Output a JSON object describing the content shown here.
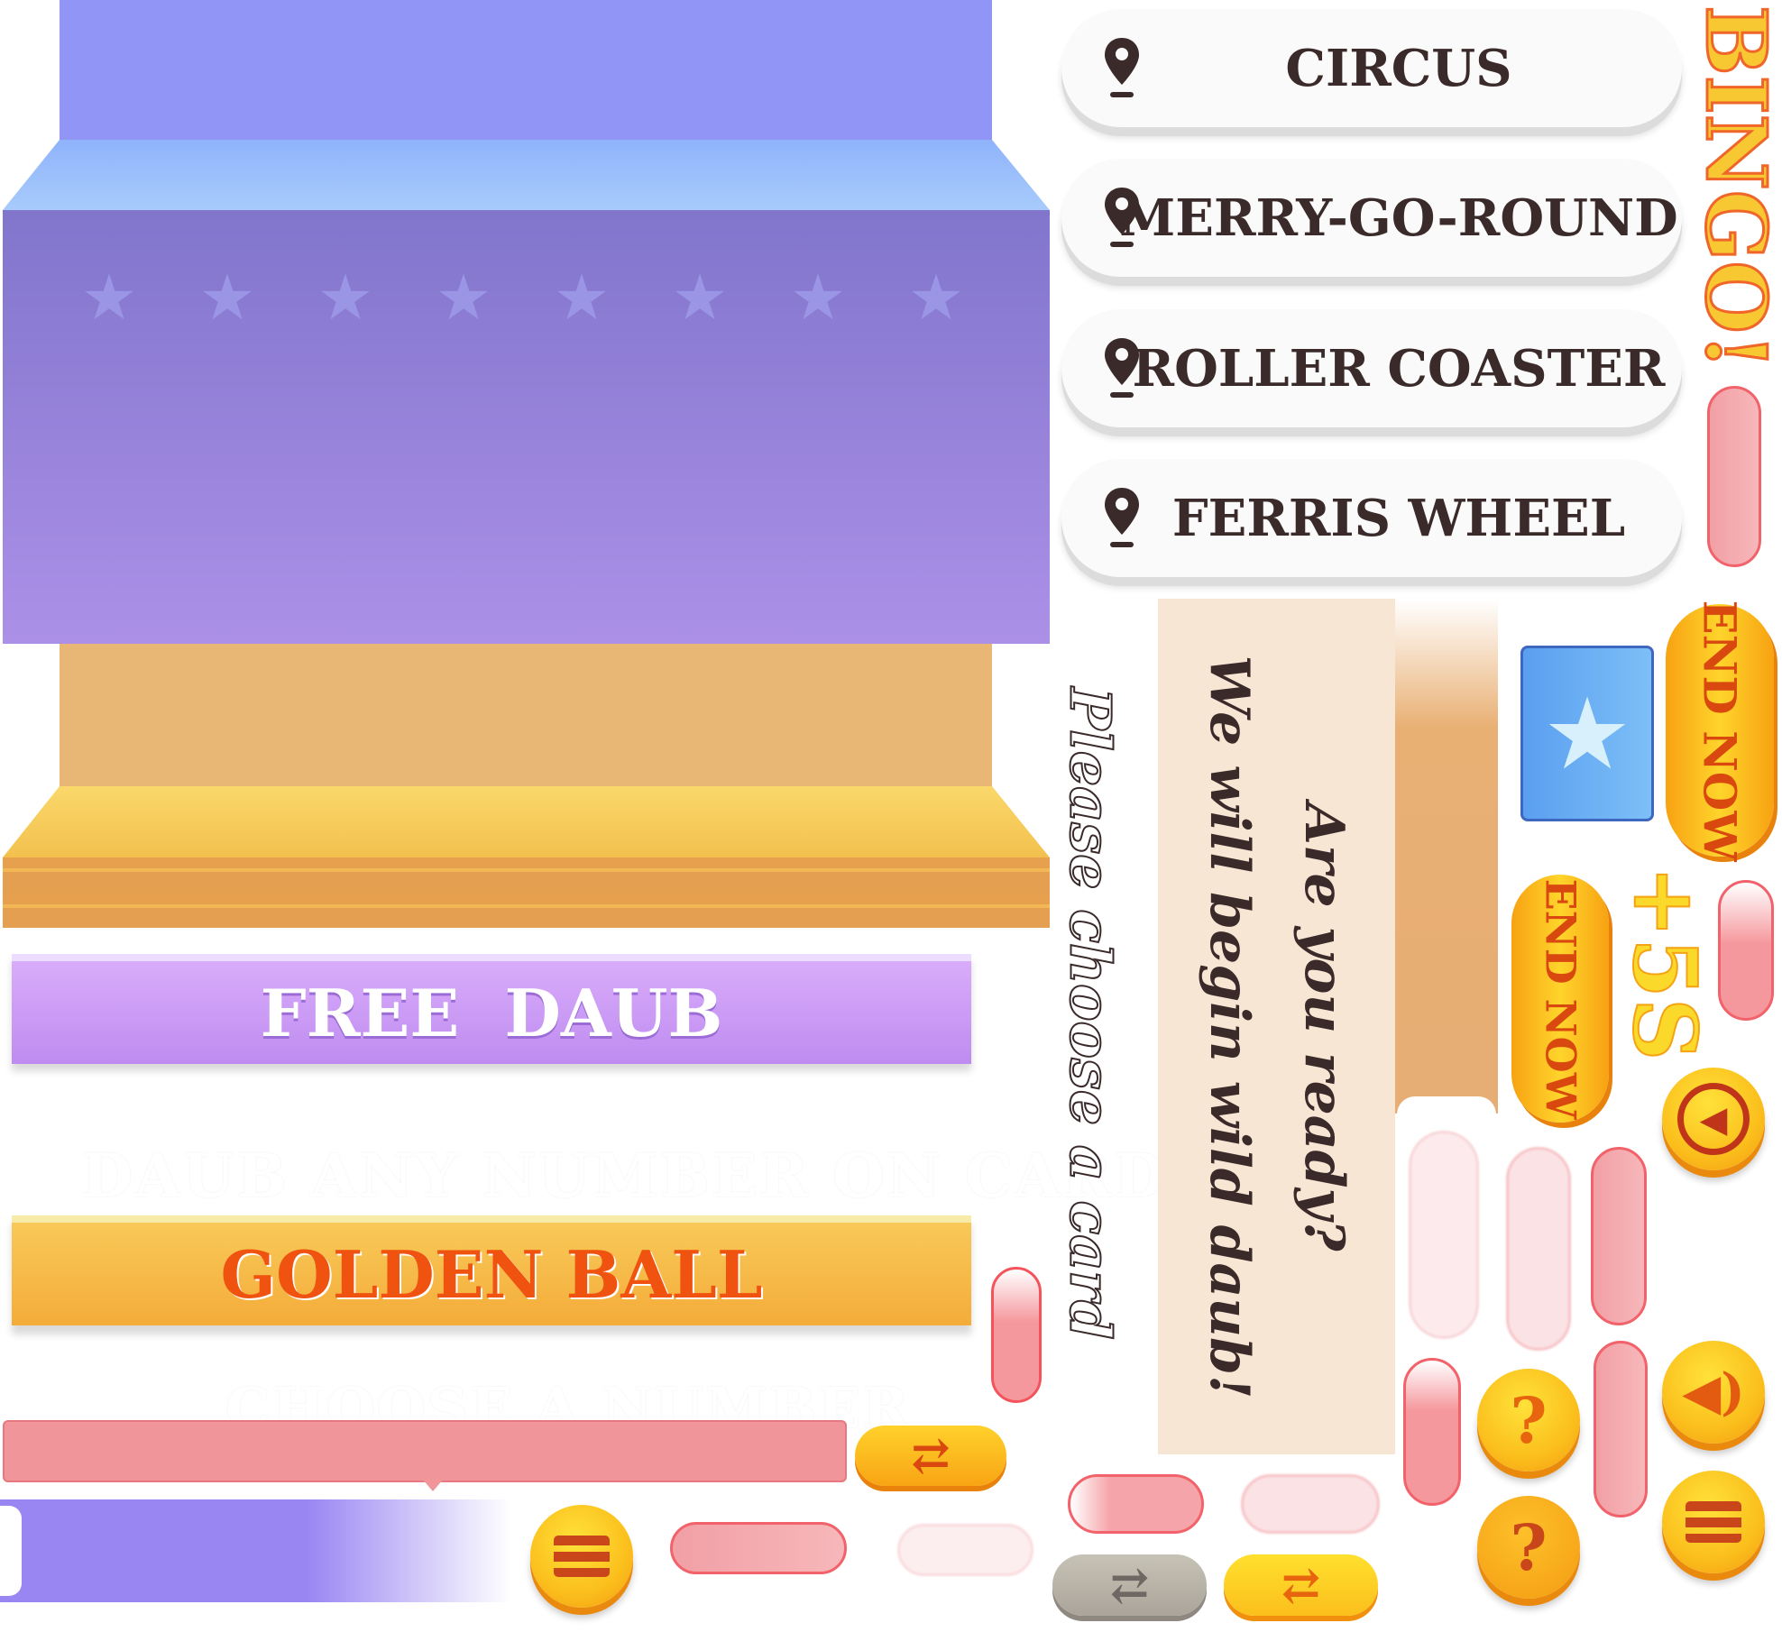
{
  "banners": {
    "free_daub": "FREE  DAUB",
    "daub_any": "DAUB ANY NUMBER ON CARD",
    "golden_ball": "GOLDEN BALL",
    "choose_number": "CHOOSE A NUMBER"
  },
  "locations": [
    {
      "label": "CIRCUS",
      "icon": "map-pin-icon"
    },
    {
      "label": "MERRY-GO-ROUND",
      "icon": "map-pin-icon"
    },
    {
      "label": "ROLLER COASTER",
      "icon": "map-pin-icon"
    },
    {
      "label": "FERRIS WHEEL",
      "icon": "map-pin-icon"
    }
  ],
  "bingo_title": "BINGO!",
  "please_choose": "Please choose a card",
  "ready_panel": {
    "line1": "Are you ready?",
    "line2": "We will begin wild daub!"
  },
  "end_now": "END NOW",
  "bonus_time": "+5S",
  "icons": {
    "help": "?",
    "star": "★",
    "refresh": "⇄"
  },
  "colors": {
    "purple": "#8a7ad0",
    "gold": "#f7b733",
    "pink": "#f0959a",
    "orange_text": "#f0520f",
    "beige": "#f8e6d4"
  }
}
